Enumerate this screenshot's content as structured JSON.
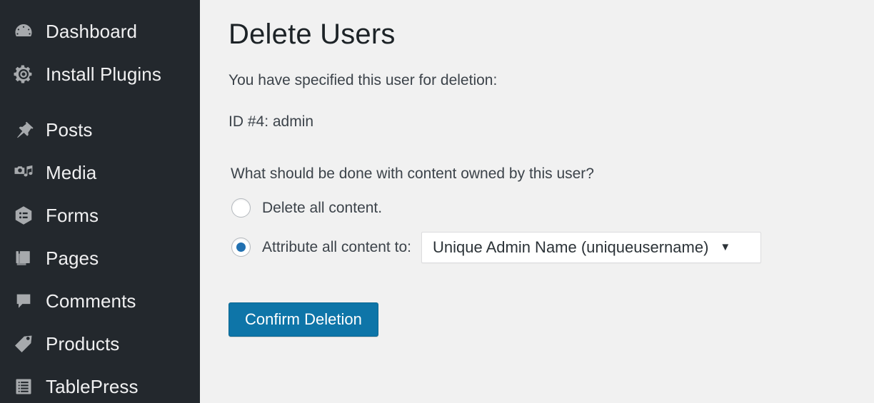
{
  "sidebar": {
    "background_color": "#23282d",
    "items": [
      {
        "label": "Dashboard",
        "icon": "dashboard-gauge-icon"
      },
      {
        "label": "Install Plugins",
        "icon": "gear-icon"
      },
      {
        "label": "Posts",
        "icon": "pushpin-icon"
      },
      {
        "label": "Media",
        "icon": "camera-music-icon"
      },
      {
        "label": "Forms",
        "icon": "hexagon-list-icon"
      },
      {
        "label": "Pages",
        "icon": "pages-stack-icon"
      },
      {
        "label": "Comments",
        "icon": "speech-bubble-icon"
      },
      {
        "label": "Products",
        "icon": "price-tag-icon"
      },
      {
        "label": "TablePress",
        "icon": "table-list-icon"
      }
    ]
  },
  "main": {
    "title": "Delete Users",
    "specified_text": "You have specified this user for deletion:",
    "user_line": "ID #4: admin",
    "question": "What should be done with content owned by this user?",
    "options": [
      {
        "label": "Delete all content.",
        "checked": false
      },
      {
        "label": "Attribute all content to:",
        "checked": true
      }
    ],
    "reassign_select": {
      "value": "Unique Admin Name (uniqueusername)",
      "arrow": "▼"
    },
    "confirm_button": {
      "label": "Confirm Deletion",
      "color": "#0e75a8"
    }
  }
}
